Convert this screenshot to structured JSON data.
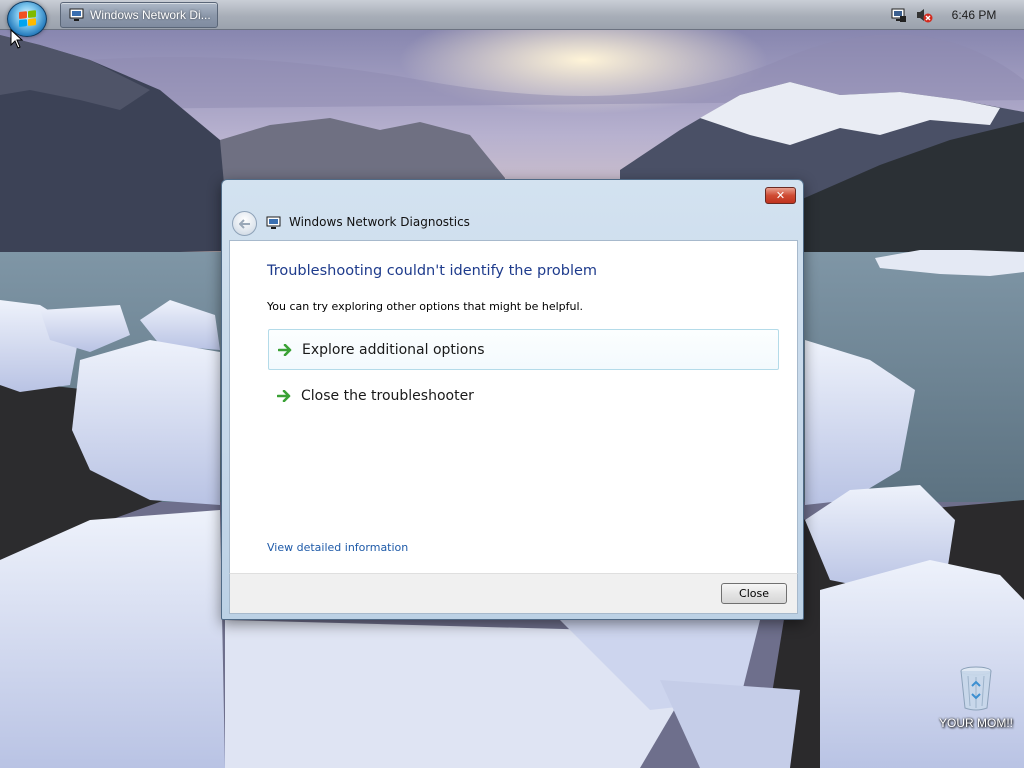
{
  "taskbar": {
    "task_button_label": "Windows Network Di...",
    "clock": "6:46 PM"
  },
  "dialog": {
    "window_title": "Windows Network Diagnostics",
    "close_glyph": "✕",
    "heading": "Troubleshooting couldn't identify the problem",
    "subtext": "You can try exploring other options that might be helpful.",
    "options": [
      {
        "label": "Explore additional options",
        "icon": "green-arrow-icon"
      },
      {
        "label": "Close the troubleshooter",
        "icon": "green-arrow-icon"
      }
    ],
    "details_link": "View detailed information",
    "close_button": "Close"
  },
  "desktop": {
    "recycle_bin_label": "YOUR MOM!!"
  },
  "colors": {
    "heading": "#1e3b8c",
    "link": "#1e5aa8",
    "option_arrow": "#3aa135",
    "title_close": "#c0331f"
  }
}
